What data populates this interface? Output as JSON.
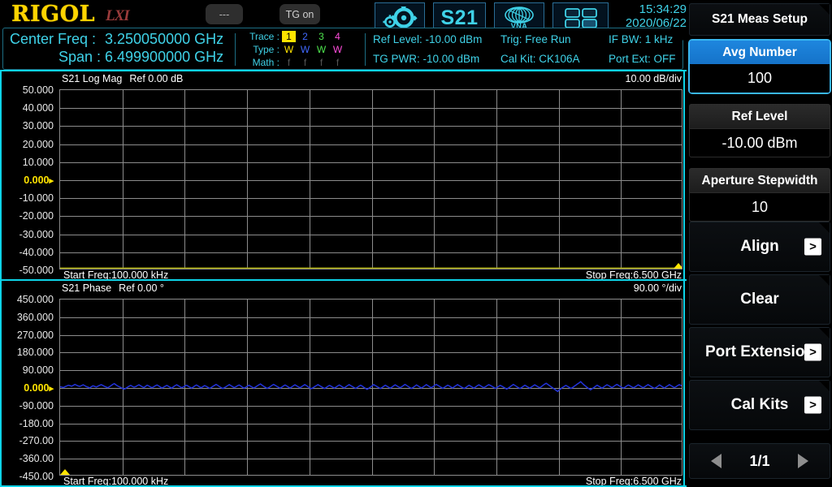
{
  "topbar": {
    "brand": "RIGOL",
    "lxi": "LXI",
    "dash_button": "---",
    "tg_button": "TG on",
    "settings_icon": "gear-icon",
    "mode_label": "S21",
    "vna_label": "VNA",
    "layout_icon": "grid-layout-icon",
    "time": "15:34:29",
    "date": "2020/06/22"
  },
  "info": {
    "center_freq_label": "Center Freq :",
    "center_freq_value": "3.250050000 GHz",
    "span_label": "Span :",
    "span_value": "6.499900000 GHz",
    "trace_label": "Trace :",
    "type_label": "Type :",
    "math_label": "Math :",
    "traces": [
      "1",
      "2",
      "3",
      "4"
    ],
    "types": [
      "W",
      "W",
      "W",
      "W"
    ],
    "maths": [
      "f",
      "f",
      "f",
      "f"
    ],
    "ref_level": "Ref Level: -10.00 dBm",
    "tg_pwr": "TG PWR: -10.00 dBm",
    "trig": "Trig: Free Run",
    "cal_kit": "Cal Kit: CK106A",
    "if_bw": "IF BW: 1 kHz",
    "port_ext": "Port Ext: OFF"
  },
  "chart_data": [
    {
      "id": "log-mag",
      "type": "line",
      "title": "S21  Log Mag",
      "reference": "Ref 0.00 dB",
      "scale_per_div": "10.00  dB/div",
      "xlabel_start": "Start Freq:100.000 kHz",
      "xlabel_stop": "Stop Freq:6.500 GHz",
      "ylabel": "dB",
      "ylim": [
        -50,
        50
      ],
      "yticks": [
        "50.000",
        "40.000",
        "30.000",
        "20.000",
        "10.000",
        "0.000",
        "-10.000",
        "-20.000",
        "-30.000",
        "-40.000",
        "-50.000"
      ],
      "ytick_values": [
        50,
        40,
        30,
        20,
        10,
        0,
        -10,
        -20,
        -30,
        -40,
        -50
      ],
      "ref_tick": "0.000",
      "grid_cols": 10,
      "grid_rows": 10,
      "trace_color": "#b4b400",
      "series": [
        {
          "name": "Trace 1 S21 Log Mag",
          "color": "#b4b400",
          "constant_value": -50,
          "note": "flat clipped line at bottom of graticule"
        }
      ],
      "marker_triangle": {
        "x_fraction": 1.0,
        "color": "#FFE400"
      }
    },
    {
      "id": "phase",
      "type": "line",
      "title": "S21  Phase",
      "reference": "Ref 0.00 °",
      "scale_per_div": "90.00  °/div",
      "xlabel_start": "Start Freq:100.000 kHz",
      "xlabel_stop": "Stop Freq:6.500 GHz",
      "ylabel": "°",
      "ylim": [
        -450,
        450
      ],
      "yticks": [
        "450.000",
        "360.000",
        "270.000",
        "180.000",
        "90.000",
        "0.000",
        "-90.000",
        "-180.00",
        "-270.00",
        "-360.00",
        "-450.00"
      ],
      "ytick_values": [
        450,
        360,
        270,
        180,
        90,
        0,
        -90,
        -180,
        -270,
        -360,
        -450
      ],
      "ref_tick": "0.000",
      "grid_cols": 10,
      "grid_rows": 10,
      "trace_color": "#2233dd",
      "series": [
        {
          "name": "Trace 2 S21 Phase",
          "color": "#2233dd",
          "mean": 0,
          "values": [
            2,
            1,
            -2,
            3,
            6,
            10,
            8,
            5,
            9,
            14,
            10,
            6,
            4,
            8,
            12,
            8,
            3,
            0,
            -4,
            2,
            7,
            4,
            1,
            5,
            9,
            13,
            9,
            4,
            1,
            -3,
            2,
            8,
            14,
            18,
            12,
            6,
            2,
            -2,
            -6,
            -10,
            -6,
            0,
            5,
            9,
            4,
            0,
            3,
            8,
            12,
            7,
            2,
            -2,
            4,
            10,
            6,
            1,
            -3,
            2,
            7,
            11,
            6,
            1,
            -4,
            0,
            5,
            9,
            4,
            -1,
            -5,
            2,
            8,
            12,
            7,
            2,
            -3,
            1,
            6,
            10,
            5,
            0,
            -5,
            0,
            6,
            11,
            6,
            1,
            -3,
            3,
            8,
            4,
            -1,
            -6,
            -2,
            4,
            9,
            14,
            9,
            3,
            -2,
            -7,
            -3,
            2,
            8,
            13,
            8,
            3,
            -2,
            2,
            7,
            11,
            6,
            0,
            -5,
            -1,
            5,
            10,
            5,
            0,
            -4,
            1,
            6,
            12,
            16,
            10,
            4,
            -1,
            -6,
            -2,
            3,
            9,
            14,
            9,
            4,
            -1,
            -5,
            0,
            6,
            11,
            6,
            1,
            -4,
            1,
            7,
            12,
            7,
            2,
            -3,
            2,
            8,
            13,
            8,
            2,
            -3,
            -8,
            -3,
            3,
            8,
            13,
            8,
            3,
            -2,
            -7,
            -2,
            4,
            9,
            5,
            0,
            -5,
            0,
            6,
            11,
            6,
            1,
            -4,
            2,
            8,
            13,
            8,
            3,
            -2,
            -6,
            -1,
            5,
            10,
            5,
            -1,
            -6,
            -11,
            -5,
            1,
            7,
            13,
            8,
            3,
            -2,
            -7,
            -2,
            4,
            10,
            5,
            0,
            -5,
            0,
            6,
            12,
            7,
            2,
            -3,
            2,
            8,
            14,
            9,
            3,
            -2,
            -6,
            -1,
            5,
            11,
            6,
            1,
            -4,
            1,
            7,
            13,
            8,
            2,
            -3,
            3,
            9,
            14,
            9,
            4,
            -1,
            -6,
            -1,
            5,
            10,
            6,
            1,
            -4,
            2,
            8,
            13,
            8,
            3,
            -2,
            -7,
            -2,
            4,
            10,
            5,
            0,
            -5,
            1,
            7,
            12,
            7,
            2,
            -3,
            2,
            8,
            13,
            9,
            4,
            -1,
            -6,
            -2,
            4,
            9,
            5,
            0,
            -5,
            -10,
            -4,
            2,
            8,
            14,
            9,
            3,
            -2,
            -7,
            -2,
            4,
            10,
            5,
            0,
            -5,
            1,
            6,
            12,
            7,
            2,
            -3,
            2,
            9,
            15,
            20,
            14,
            8,
            2,
            -4,
            -10,
            -16,
            -22,
            -14,
            -7,
            -1,
            4,
            9,
            4,
            -1,
            -6,
            -2,
            4,
            10,
            16,
            22,
            28,
            20,
            12,
            5,
            -2,
            -8,
            -14,
            -8,
            -2,
            4,
            10,
            5,
            0,
            -5,
            1,
            7,
            12,
            8,
            3,
            -2,
            3,
            9,
            14,
            9,
            4,
            -1,
            -5,
            0,
            6,
            11,
            7,
            2,
            -3,
            1,
            6,
            12,
            7,
            2,
            -3,
            2,
            8,
            13,
            8,
            3,
            -2,
            -6,
            -1,
            5,
            11,
            6,
            1,
            -4,
            2,
            7,
            13,
            8,
            3,
            -2,
            2,
            8,
            13,
            9,
            4
          ]
        }
      ],
      "marker_triangle": {
        "x_fraction": 0.0,
        "color": "#FFE400"
      }
    }
  ],
  "sidemenu": {
    "header": "S21 Meas Setup",
    "items": [
      {
        "type": "value",
        "label": "Avg Number",
        "value": "100",
        "selected": true
      },
      {
        "type": "value",
        "label": "Ref Level",
        "value": "-10.00 dBm",
        "selected": false
      },
      {
        "type": "value",
        "label": "Aperture Stepwidth",
        "value": "10",
        "selected": false
      },
      {
        "type": "plain",
        "label": "Align",
        "arrow": ">"
      },
      {
        "type": "plain",
        "label": "Clear",
        "arrow": ""
      },
      {
        "type": "plain",
        "label": "Port Extension",
        "arrow": ">"
      },
      {
        "type": "plain",
        "label": "Cal Kits",
        "arrow": ">"
      }
    ],
    "pager": {
      "prev_icon": "triangle-left-icon",
      "page": "1/1",
      "next_icon": "triangle-right-icon"
    }
  }
}
